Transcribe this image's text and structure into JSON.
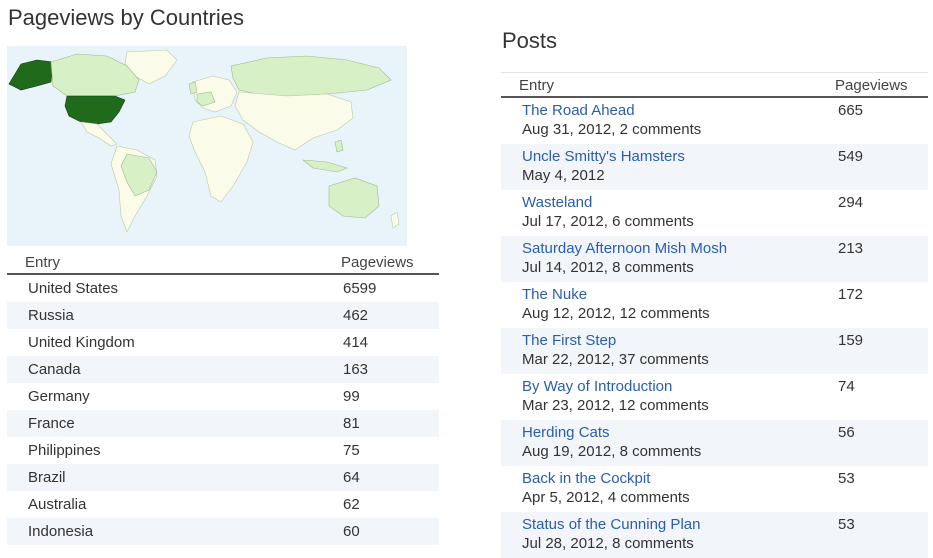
{
  "countries": {
    "title": "Pageviews by Countries",
    "col_entry": "Entry",
    "col_pageviews": "Pageviews",
    "colors": {
      "ocean": "#e9f3fa",
      "land": "#fbfbe9",
      "low": "#d7f0c6",
      "high": "#1f6b1b"
    },
    "rows": [
      {
        "name": "United States",
        "views": "6599"
      },
      {
        "name": "Russia",
        "views": "462"
      },
      {
        "name": "United Kingdom",
        "views": "414"
      },
      {
        "name": "Canada",
        "views": "163"
      },
      {
        "name": "Germany",
        "views": "99"
      },
      {
        "name": "France",
        "views": "81"
      },
      {
        "name": "Philippines",
        "views": "75"
      },
      {
        "name": "Brazil",
        "views": "64"
      },
      {
        "name": "Australia",
        "views": "62"
      },
      {
        "name": "Indonesia",
        "views": "60"
      }
    ]
  },
  "posts": {
    "title": "Posts",
    "col_entry": "Entry",
    "col_pageviews": "Pageviews",
    "link_color": "#2a5db0",
    "rows": [
      {
        "title": "The Road Ahead",
        "meta": "Aug 31, 2012, 2 comments",
        "views": "665"
      },
      {
        "title": "Uncle Smitty's Hamsters",
        "meta": "May 4, 2012",
        "views": "549"
      },
      {
        "title": "Wasteland",
        "meta": "Jul 17, 2012, 6 comments",
        "views": "294"
      },
      {
        "title": "Saturday Afternoon Mish Mosh",
        "meta": "Jul 14, 2012, 8 comments",
        "views": "213"
      },
      {
        "title": "The Nuke",
        "meta": "Aug 12, 2012, 12 comments",
        "views": "172"
      },
      {
        "title": "The First Step",
        "meta": "Mar 22, 2012, 37 comments",
        "views": "159"
      },
      {
        "title": "By Way of Introduction",
        "meta": "Mar 23, 2012, 12 comments",
        "views": "74"
      },
      {
        "title": "Herding Cats",
        "meta": "Aug 19, 2012, 8 comments",
        "views": "56"
      },
      {
        "title": "Back in the Cockpit",
        "meta": "Apr 5, 2012, 4 comments",
        "views": "53"
      },
      {
        "title": "Status of the Cunning Plan",
        "meta": "Jul 28, 2012, 8 comments",
        "views": "53"
      }
    ]
  }
}
